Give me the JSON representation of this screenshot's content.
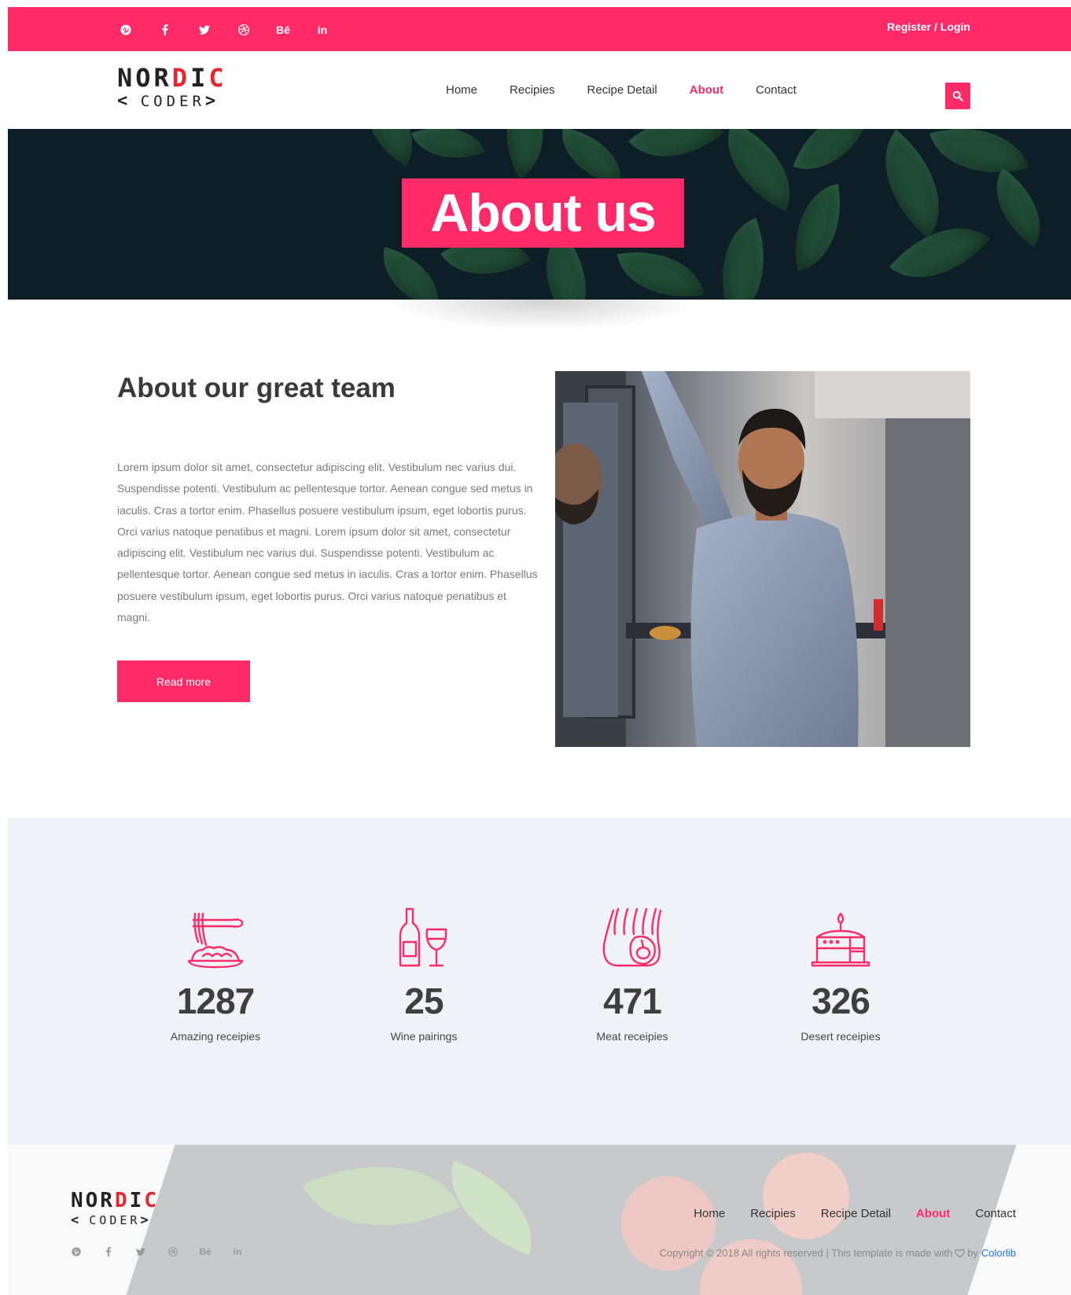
{
  "topbar": {
    "social": [
      {
        "name": "pinterest-icon",
        "glyph": ""
      },
      {
        "name": "facebook-icon",
        "glyph": "f"
      },
      {
        "name": "twitter-icon",
        "glyph": ""
      },
      {
        "name": "dribbble-icon",
        "glyph": ""
      },
      {
        "name": "behance-icon",
        "glyph": "Bē"
      },
      {
        "name": "linkedin-icon",
        "glyph": "in"
      }
    ],
    "register": "Register",
    "separator": "/",
    "login": "Login"
  },
  "logo": {
    "part1": "NOR",
    "part_red": "D",
    "part2": "I",
    "part_red2": "C",
    "sub_left": "<",
    "sub": "CODER",
    "sub_right": ">"
  },
  "nav": {
    "items": [
      "Home",
      "Recipies",
      "Recipe Detail",
      "About",
      "Contact"
    ],
    "active": "About",
    "search_icon": "search-icon"
  },
  "hero": {
    "title": "About us"
  },
  "about": {
    "title": "About our great team",
    "text": "Lorem ipsum dolor sit amet, consectetur adipiscing elit. Vestibulum nec varius dui. Suspendisse potenti. Vestibulum ac pellentesque tortor. Aenean congue sed metus in iaculis. Cras a tortor enim. Phasellus posuere vestibulum ipsum, eget lobortis purus. Orci varius natoque penatibus et magni. Lorem ipsum dolor sit amet, consectetur adipiscing elit. Vestibulum nec varius dui. Suspendisse potenti. Vestibulum ac pellentesque tortor. Aenean congue sed metus in iaculis. Cras a tortor enim. Phasellus posuere vestibulum ipsum, eget lobortis purus. Orci varius natoque penatibus et magni.",
    "button": "Read more"
  },
  "stats": [
    {
      "icon": "noodles-icon",
      "value": "1287",
      "label": "Amazing receipies"
    },
    {
      "icon": "wine-icon",
      "value": "25",
      "label": "Wine pairings"
    },
    {
      "icon": "meat-icon",
      "value": "471",
      "label": "Meat receipies"
    },
    {
      "icon": "cake-icon",
      "value": "326",
      "label": "Desert receipies"
    }
  ],
  "footer": {
    "menu": [
      "Home",
      "Recipies",
      "Recipe Detail",
      "About",
      "Contact"
    ],
    "active": "About",
    "copyright": "Copyright © 2018 All rights reserved | This template is made with",
    "by": "by",
    "brand": "Colorlib"
  },
  "colors": {
    "accent": "#ff2a68",
    "link": "#1a73e8"
  }
}
